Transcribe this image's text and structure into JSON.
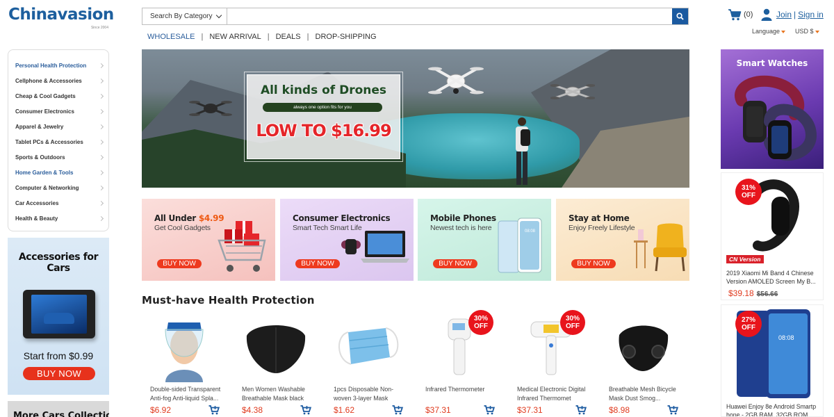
{
  "header": {
    "logo_text": "Chinavasion",
    "logo_since": "Since 2004",
    "search": {
      "category_label": "Search By Category",
      "placeholder": ""
    },
    "cart_count": "(0)",
    "join_label": "Join",
    "signin_label": "Sign in",
    "language_label": "Language",
    "currency_label": "USD $"
  },
  "nav": [
    {
      "label": "WHOLESALE"
    },
    {
      "label": "NEW ARRIVAL"
    },
    {
      "label": "DEALS"
    },
    {
      "label": "DROP-SHIPPING"
    }
  ],
  "categories": [
    {
      "label": "Personal Health Protection"
    },
    {
      "label": "Cellphone & Accessories"
    },
    {
      "label": "Cheap & Cool Gadgets"
    },
    {
      "label": "Consumer Electronics"
    },
    {
      "label": "Apparel & Jewelry"
    },
    {
      "label": "Tablet PCs & Accessories"
    },
    {
      "label": "Sports & Outdoors"
    },
    {
      "label": "Home Garden & Tools"
    },
    {
      "label": "Computer & Networking"
    },
    {
      "label": "Car Accessories"
    },
    {
      "label": "Health & Beauty"
    }
  ],
  "car_ad": {
    "title": "Accessories for Cars",
    "start": "Start from $0.99",
    "button": "BUY NOW"
  },
  "more_ad": {
    "title": "More Cars Collection"
  },
  "hero": {
    "title": "All kinds of Drones",
    "pill": "always one option fits for you",
    "price": "LOW TO $16.99"
  },
  "promos": [
    {
      "title_prefix": "All Under ",
      "title_price": "$4.99",
      "subtitle": "Get Cool Gadgets",
      "button": "BUY NOW",
      "bg": "#f8d2cf"
    },
    {
      "title_prefix": "Consumer Electronics",
      "title_price": "",
      "subtitle": "Smart Tech Smart Life",
      "button": "BUY NOW",
      "bg": "#e4d3f3"
    },
    {
      "title_prefix": "Mobile Phones",
      "title_price": "",
      "subtitle": "Newest tech is here",
      "button": "BUY NOW",
      "bg": "#c9efe0"
    },
    {
      "title_prefix": "Stay at Home",
      "title_price": "",
      "subtitle": "Enjoy Freely Lifestyle",
      "button": "BUY NOW",
      "bg": "#fbe6c8"
    }
  ],
  "section": {
    "title": "Must-have Health Protection"
  },
  "products": [
    {
      "name": "Double-sided Transparent Anti-fog Anti-liquid Spla...",
      "price": "$6.92",
      "badge_pct": "",
      "badge_off": ""
    },
    {
      "name": "Men Women Washable Breathable Mask black",
      "price": "$4.38",
      "badge_pct": "",
      "badge_off": ""
    },
    {
      "name": "1pcs Disposable Non-woven 3-layer Mask",
      "price": "$1.62",
      "badge_pct": "",
      "badge_off": ""
    },
    {
      "name": "Infrared Thermometer",
      "price": "$37.31",
      "badge_pct": "30%",
      "badge_off": "OFF"
    },
    {
      "name": "Medical Electronic Digital Infrared Thermomet",
      "price": "$37.31",
      "badge_pct": "30%",
      "badge_off": "OFF"
    },
    {
      "name": "Breathable Mesh Bicycle Mask Dust Smog...",
      "price": "$8.98",
      "badge_pct": "",
      "badge_off": ""
    }
  ],
  "watch_ad": {
    "title": "Smart Watches"
  },
  "side_products": [
    {
      "badge_pct": "31%",
      "badge_off": "OFF",
      "tag": "CN Version",
      "name": "2019 Xiaomi Mi Band 4 Chinese Version AMOLED Screen My B...",
      "price": "$39.18",
      "old_price": "$56.66"
    },
    {
      "badge_pct": "27%",
      "badge_off": "OFF",
      "tag": "",
      "name": "Huawei Enjoy 8e Android Smartp hone - 2GB RAM, 32GB ROM, ...",
      "price": "",
      "old_price": ""
    }
  ],
  "colors": {
    "brand_blue": "#1d5f9e",
    "sale_red": "#e03a1e",
    "badge_red": "#e8141c",
    "button_orange_red": "#ee3a1f"
  }
}
